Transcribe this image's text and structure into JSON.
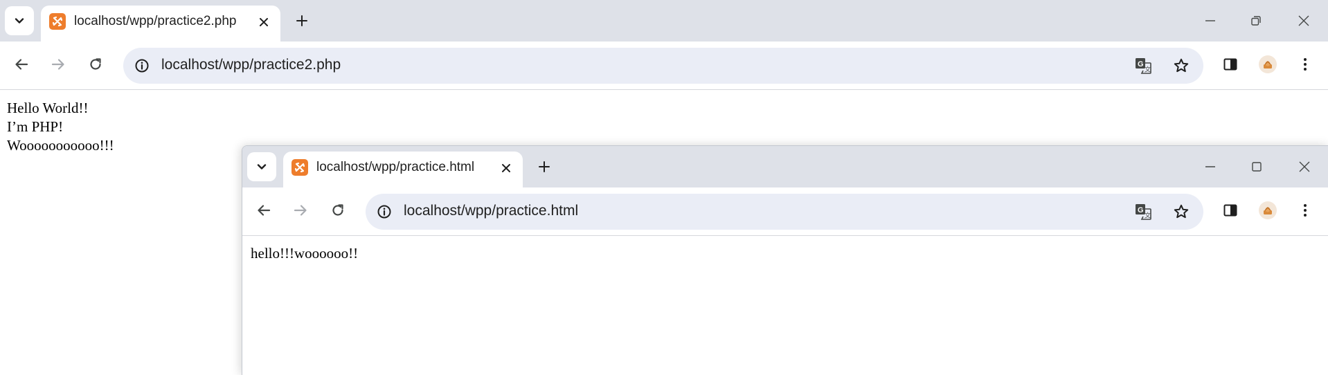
{
  "main_window": {
    "tab": {
      "title": "localhost/wpp/practice2.php",
      "favicon": "xampp-icon"
    },
    "url": "localhost/wpp/practice2.php",
    "content": [
      "Hello World!!",
      "I’m PHP!",
      "Wooooooooooo!!!"
    ]
  },
  "popup_window": {
    "tab": {
      "title": "localhost/wpp/practice.html",
      "favicon": "xampp-icon"
    },
    "url": "localhost/wpp/practice.html",
    "content": "hello!!!woooooo!!"
  },
  "colors": {
    "tabstrip": "#dee1e8",
    "omnibox": "#eaedf6",
    "favicon": "#ee7d2c",
    "icon": "#444746",
    "disabled_icon": "#a8abb0"
  },
  "icons": [
    "tab-search-icon",
    "close-icon",
    "plus-icon",
    "minimize-icon",
    "restore-icon",
    "maximize-icon",
    "back-arrow-icon",
    "forward-arrow-icon",
    "reload-icon",
    "info-icon",
    "translate-icon",
    "star-icon",
    "side-panel-icon",
    "profile-avatar",
    "kebab-menu-icon"
  ]
}
